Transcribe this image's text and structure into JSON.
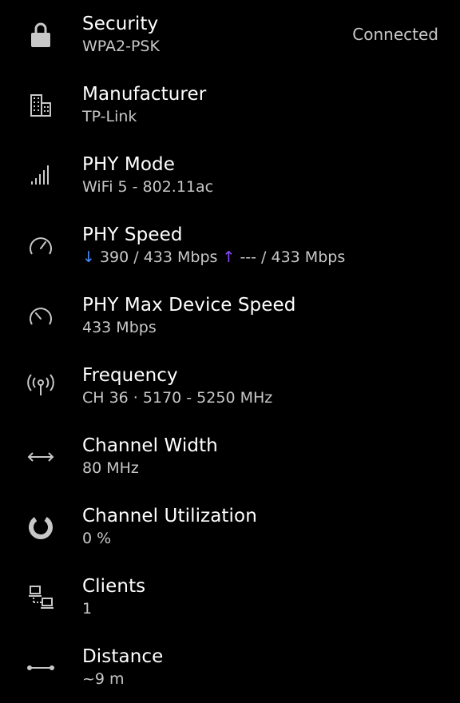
{
  "connection_status": "Connected",
  "rows": [
    {
      "title": "Security",
      "value": "WPA2-PSK",
      "icon": "lock-icon"
    },
    {
      "title": "Manufacturer",
      "value": "TP-Link",
      "icon": "building-icon"
    },
    {
      "title": "PHY Mode",
      "value": "WiFi 5 - 802.11ac",
      "icon": "signal-bars-icon"
    },
    {
      "title": "PHY Speed",
      "download_arrow": "↓",
      "download": "390 / 433 Mbps",
      "upload_arrow": "↑",
      "upload": "--- / 433 Mbps",
      "icon": "speedometer-icon"
    },
    {
      "title": "PHY Max Device Speed",
      "value": "433 Mbps",
      "icon": "speedometer-max-icon"
    },
    {
      "title": "Frequency",
      "value": "CH 36 · 5170 - 5250 MHz",
      "icon": "antenna-icon"
    },
    {
      "title": "Channel Width",
      "value": "80 MHz",
      "icon": "horizontal-arrows-icon"
    },
    {
      "title": "Channel Utilization",
      "value": "0 %",
      "icon": "donut-icon"
    },
    {
      "title": "Clients",
      "value": "1",
      "icon": "devices-icon"
    },
    {
      "title": "Distance",
      "value": "~9 m",
      "icon": "distance-icon"
    }
  ],
  "colors": {
    "background": "#000000",
    "title": "#ffffff",
    "value": "#c8c8c8",
    "icon": "#c8c8c8",
    "download_arrow": "#4a8cff",
    "upload_arrow": "#8a4dff"
  }
}
